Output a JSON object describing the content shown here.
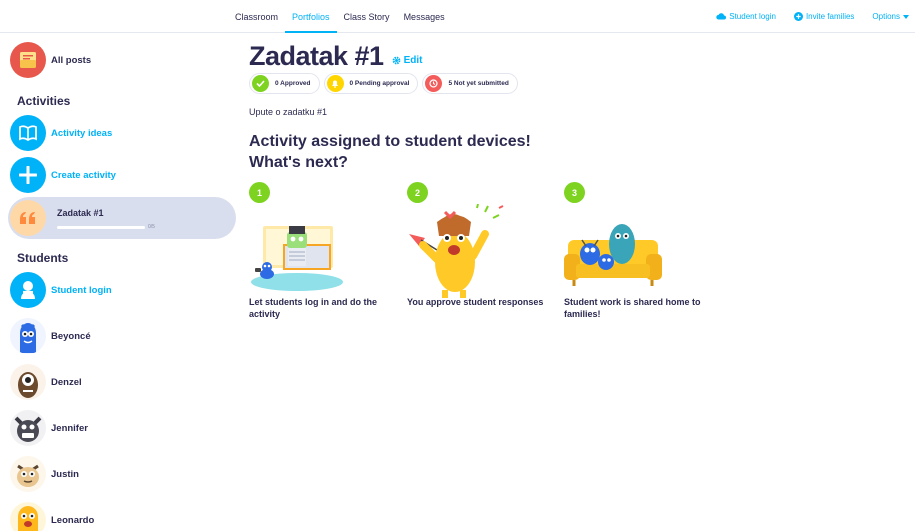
{
  "nav": {
    "tabs": [
      {
        "label": "Classroom"
      },
      {
        "label": "Portfolios"
      },
      {
        "label": "Class Story"
      },
      {
        "label": "Messages"
      }
    ],
    "student_login": "Student login",
    "invite_families": "Invite families",
    "options": "Options"
  },
  "sidebar": {
    "all_posts": "All posts",
    "activities_title": "Activities",
    "activity_ideas": "Activity ideas",
    "create_activity": "Create activity",
    "selected_activity": {
      "title": "Zadatak #1",
      "progress_text": "0/5",
      "progress_fraction": 0
    },
    "students_title": "Students",
    "student_login": "Student login",
    "students": [
      {
        "name": "Beyoncé"
      },
      {
        "name": "Denzel"
      },
      {
        "name": "Jennifer"
      },
      {
        "name": "Justin"
      },
      {
        "name": "Leonardo"
      }
    ]
  },
  "main": {
    "title": "Zadatak #1",
    "edit": "Edit",
    "pills": {
      "approved": "0 Approved",
      "pending": "0 Pending approval",
      "not_submitted": "5 Not yet submitted"
    },
    "instructions": "Upute o zadatku #1",
    "headline_line1": "Activity assigned to student devices!",
    "headline_line2": "What's next?",
    "steps": [
      {
        "num": "1",
        "caption": "Let students log in and do the activity"
      },
      {
        "num": "2",
        "caption": "You approve student responses"
      },
      {
        "num": "3",
        "caption": "Student work is shared home to families!"
      }
    ]
  },
  "colors": {
    "accent": "#00b2f7",
    "text": "#2c2a50",
    "green": "#7ed321",
    "yellow": "#ffd600",
    "red": "#f45b5b",
    "selected_bg": "#d9deee"
  }
}
